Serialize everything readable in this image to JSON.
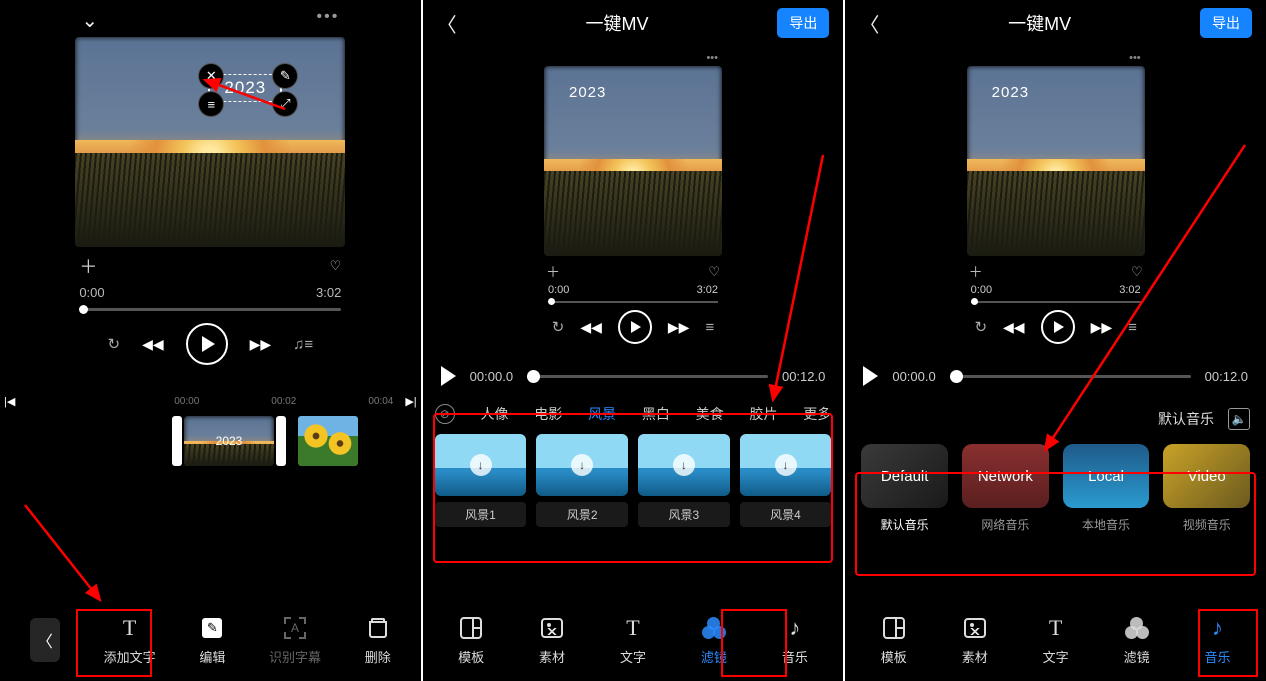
{
  "shared": {
    "header_title": "一键MV",
    "export_label": "导出",
    "year_text": "2023",
    "timeline_start": "00:00.0",
    "timeline_end": "00:12.0"
  },
  "panel1": {
    "preview": {
      "time_start": "0:00",
      "time_end": "3:02"
    },
    "timeline_ticks": [
      "00:00",
      "00:02",
      "00:04"
    ],
    "strip_label": "2023",
    "toolbar": {
      "add_text": "添加文字",
      "edit": "编辑",
      "recognize": "识别字幕",
      "delete": "删除"
    }
  },
  "panel2": {
    "preview": {
      "time_start": "0:00",
      "time_end": "3:02"
    },
    "filter_cats": [
      "人像",
      "电影",
      "风景",
      "黑白",
      "美食",
      "胶片",
      "更多"
    ],
    "filter_active_index": 2,
    "filters": [
      "风景1",
      "风景2",
      "风景3",
      "风景4"
    ],
    "toolbar": {
      "template": "模板",
      "material": "素材",
      "text": "文字",
      "filter": "滤镜",
      "music": "音乐"
    }
  },
  "panel3": {
    "preview": {
      "time_start": "0:00",
      "time_end": "3:02"
    },
    "default_music_label": "默认音乐",
    "music_items": [
      {
        "big": "Default",
        "lab": "默认音乐",
        "cls": "def"
      },
      {
        "big": "Network",
        "lab": "网络音乐",
        "cls": "net"
      },
      {
        "big": "Local",
        "lab": "本地音乐",
        "cls": "loc"
      },
      {
        "big": "Video",
        "lab": "视频音乐",
        "cls": "vid"
      }
    ],
    "music_active_index": 0,
    "toolbar": {
      "template": "模板",
      "material": "素材",
      "text": "文字",
      "filter": "滤镜",
      "music": "音乐"
    }
  }
}
